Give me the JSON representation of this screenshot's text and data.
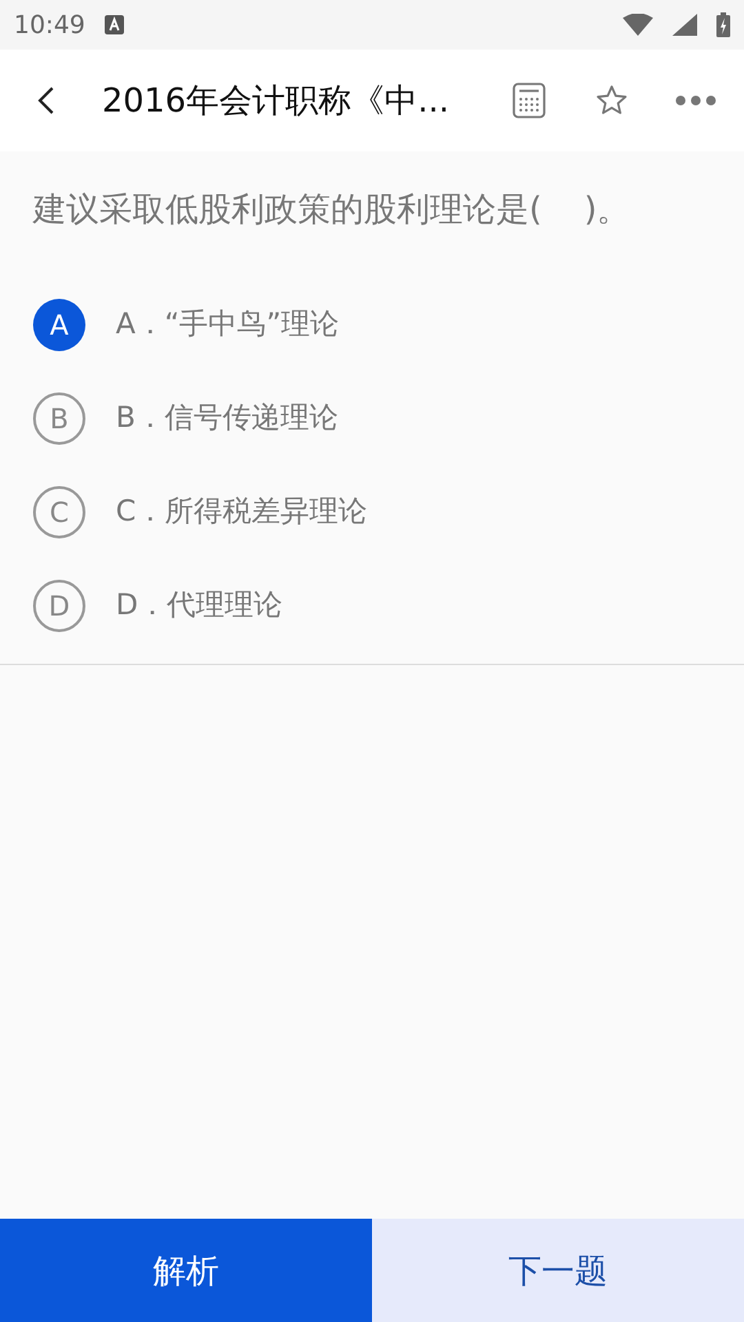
{
  "status_bar": {
    "time": "10:49"
  },
  "header": {
    "title": "2016年会计职称《中..."
  },
  "question": {
    "text": "建议采取低股利政策的股利理论是(    )。"
  },
  "options": [
    {
      "letter": "A",
      "text": "A．“手中鸟”理论",
      "selected": true
    },
    {
      "letter": "B",
      "text": "B．信号传递理论",
      "selected": false
    },
    {
      "letter": "C",
      "text": "C．所得税差异理论",
      "selected": false
    },
    {
      "letter": "D",
      "text": "D．代理理论",
      "selected": false
    }
  ],
  "bottom_bar": {
    "analysis": "解析",
    "next": "下一题"
  }
}
